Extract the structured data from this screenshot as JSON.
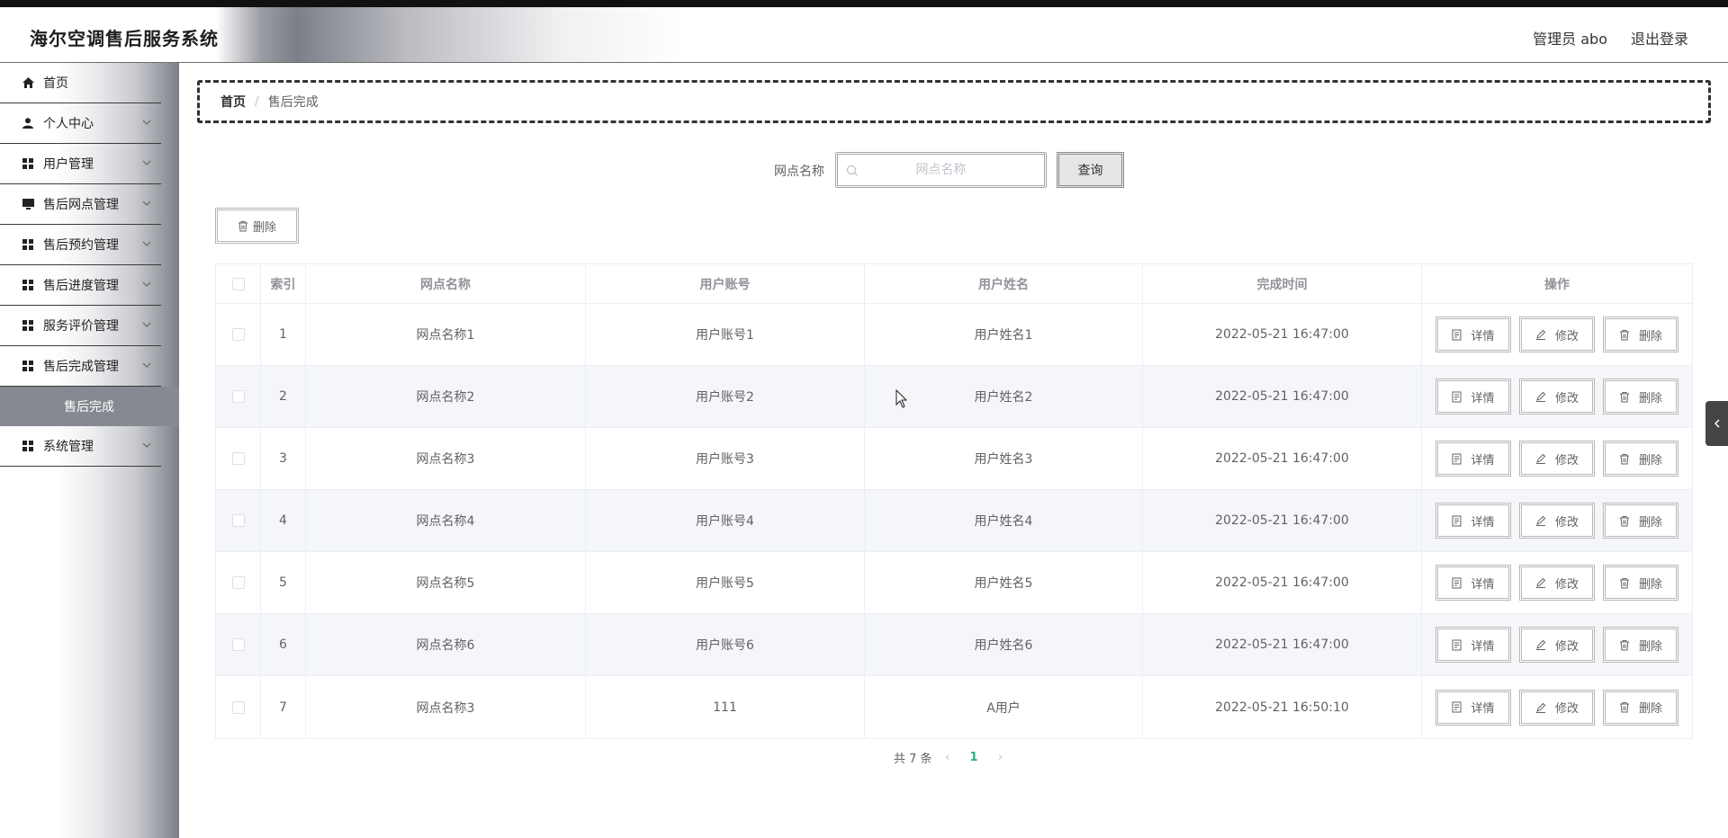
{
  "header": {
    "title": "海尔空调售后服务系统",
    "user": "管理员 abo",
    "logout": "退出登录"
  },
  "sidebar": {
    "items": [
      {
        "label": "首页",
        "icon": "home-icon"
      },
      {
        "label": "个人中心",
        "icon": "user-icon"
      },
      {
        "label": "用户管理",
        "icon": "grid-icon"
      },
      {
        "label": "售后网点管理",
        "icon": "monitor-icon"
      },
      {
        "label": "售后预约管理",
        "icon": "grid-icon"
      },
      {
        "label": "售后进度管理",
        "icon": "grid-icon"
      },
      {
        "label": "服务评价管理",
        "icon": "grid-icon"
      },
      {
        "label": "售后完成管理",
        "icon": "grid-icon"
      }
    ],
    "active_sub": "售后完成",
    "last_item": {
      "label": "系统管理",
      "icon": "grid-icon"
    }
  },
  "breadcrumb": {
    "home": "首页",
    "separator": "/",
    "current": "售后完成"
  },
  "search": {
    "label": "网点名称",
    "placeholder": "网点名称",
    "value": "",
    "button": "查询"
  },
  "toolbar": {
    "delete_label": "删除"
  },
  "table": {
    "columns": [
      "索引",
      "网点名称",
      "用户账号",
      "用户姓名",
      "完成时间",
      "操作"
    ],
    "rows": [
      {
        "index": "1",
        "name": "网点名称1",
        "account": "用户账号1",
        "username": "用户姓名1",
        "time": "2022-05-21 16:47:00"
      },
      {
        "index": "2",
        "name": "网点名称2",
        "account": "用户账号2",
        "username": "用户姓名2",
        "time": "2022-05-21 16:47:00"
      },
      {
        "index": "3",
        "name": "网点名称3",
        "account": "用户账号3",
        "username": "用户姓名3",
        "time": "2022-05-21 16:47:00"
      },
      {
        "index": "4",
        "name": "网点名称4",
        "account": "用户账号4",
        "username": "用户姓名4",
        "time": "2022-05-21 16:47:00"
      },
      {
        "index": "5",
        "name": "网点名称5",
        "account": "用户账号5",
        "username": "用户姓名5",
        "time": "2022-05-21 16:47:00"
      },
      {
        "index": "6",
        "name": "网点名称6",
        "account": "用户账号6",
        "username": "用户姓名6",
        "time": "2022-05-21 16:47:00"
      },
      {
        "index": "7",
        "name": "网点名称3",
        "account": "111",
        "username": "A用户",
        "time": "2022-05-21 16:50:10"
      }
    ],
    "actions": {
      "detail": "详情",
      "edit": "修改",
      "delete": "删除"
    }
  },
  "pagination": {
    "total_text": "共 7 条",
    "current_page": "1",
    "prev": "‹",
    "next": "›"
  },
  "colors": {
    "accent": "#23b47e",
    "sidebar_active": "#868991"
  }
}
